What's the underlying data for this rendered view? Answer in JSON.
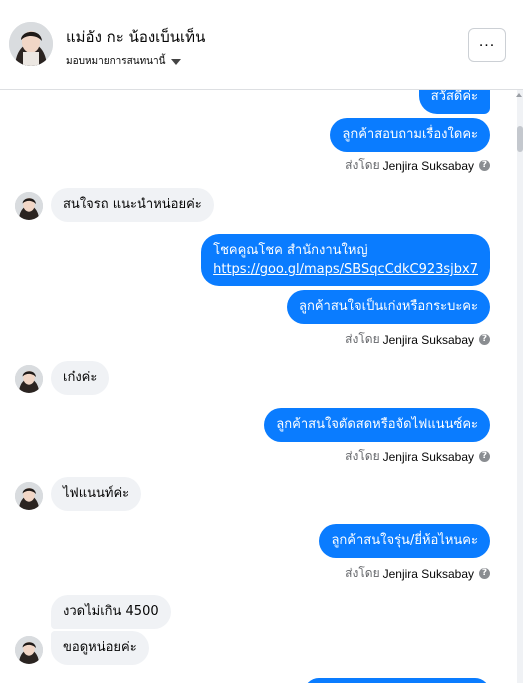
{
  "header": {
    "contact_name": "แม่อัง กะ น้องเบ็นเท็น",
    "assign_label": "มอบหมายการสนทนานี้"
  },
  "messages": [
    {
      "dir": "out",
      "text": "สวัสดีค่ะ"
    },
    {
      "dir": "out",
      "text": "ลูกค้าสอบถามเรื่องใดคะ"
    },
    {
      "dir": "in",
      "text": "สนใจรถ แนะนำหน่อยค่ะ"
    },
    {
      "dir": "out",
      "line1": "โชคคูณโชค สำนักงานใหญ่",
      "link": "https://goo.gl/maps/SBSqcCdkC923sjbx7"
    },
    {
      "dir": "out",
      "text": "ลูกค้าสนใจเป็นเก่งหรือกระบะคะ"
    },
    {
      "dir": "in",
      "text": "เก๋งค่ะ"
    },
    {
      "dir": "out",
      "text": "ลูกค้าสนใจตัดสดหรือจัดไฟแนนซ์คะ"
    },
    {
      "dir": "in",
      "text": "ไฟแนนท์ค่ะ"
    },
    {
      "dir": "out",
      "text": "ลูกค้าสนใจรุ่น/ยี่ห้อไหนคะ"
    },
    {
      "dir": "in",
      "text": "งวดไม่เกิน 4500"
    },
    {
      "dir": "in",
      "text": "ขอดูหน่อยค่ะ"
    }
  ],
  "sent_by": {
    "prefix": "ส่งโดย",
    "name": "Jenjira Suksabay"
  },
  "colors": {
    "outgoing": "#0a7cff",
    "incoming": "#f0f2f5"
  }
}
